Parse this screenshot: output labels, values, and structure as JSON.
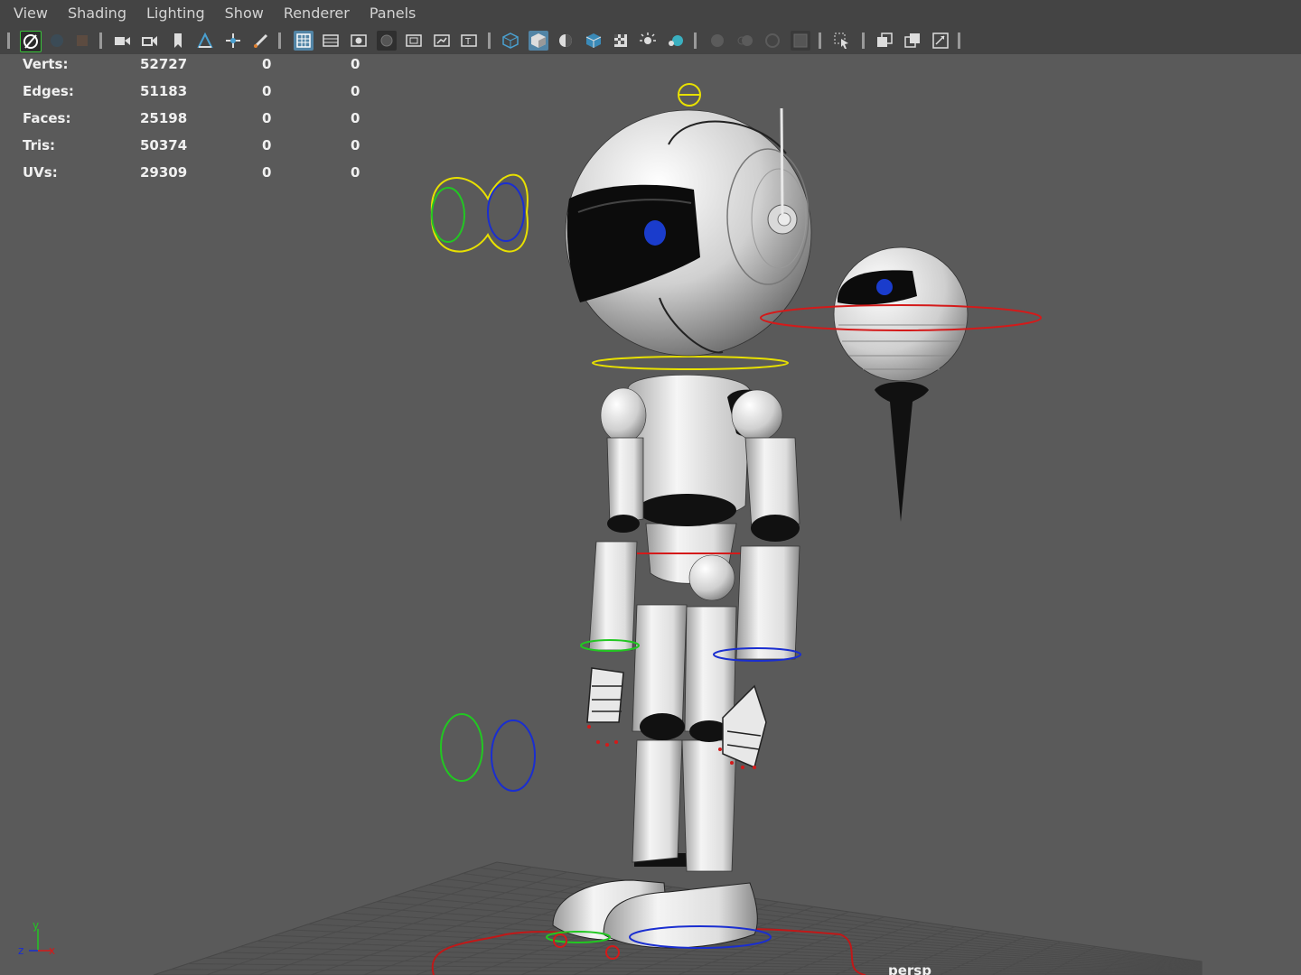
{
  "menu": {
    "items": [
      "View",
      "Shading",
      "Lighting",
      "Show",
      "Renderer",
      "Panels"
    ]
  },
  "toolbar": {
    "icons": [
      "select-camera-icon",
      "lock-camera-icon",
      "bookmark-icon",
      "camera-attributes-icon",
      "camera-bookmark-icon",
      "image-plane-icon",
      "two-d-pan-zoom-icon",
      "grease-pencil-icon",
      "grid-icon",
      "film-gate-icon",
      "resolution-gate-icon",
      "gate-mask-icon",
      "field-chart-icon",
      "safe-action-icon",
      "safe-title-icon",
      "wireframe-icon",
      "smooth-shade-icon",
      "wireframe-on-shaded-icon",
      "textured-icon",
      "use-all-lights-icon",
      "shadows-icon",
      "xray-icon",
      "isolate-select-icon",
      "ambient-occlusion-icon",
      "motion-blur-icon",
      "antialiasing-icon",
      "depth-of-field-icon",
      "xray-joints-icon",
      "pan-zoom-icon",
      "panel-layout-icon",
      "toggle-panel-icon",
      "fullscreen-icon"
    ],
    "accent_color": "#5285a6"
  },
  "hud": {
    "rows": [
      {
        "label": "Verts:",
        "values": [
          "52727",
          "0",
          "0"
        ]
      },
      {
        "label": "Edges:",
        "values": [
          "51183",
          "0",
          "0"
        ]
      },
      {
        "label": "Faces:",
        "values": [
          "25198",
          "0",
          "0"
        ]
      },
      {
        "label": "Tris:",
        "values": [
          "50374",
          "0",
          "0"
        ]
      },
      {
        "label": "UVs:",
        "values": [
          "29309",
          "0",
          "0"
        ]
      }
    ]
  },
  "viewport": {
    "camera_label": "persp",
    "axis_labels": {
      "x": "x",
      "y": "y",
      "z": "z"
    },
    "background_color": "#5a5a5a",
    "control_colors": {
      "yellow": "#e8e000",
      "green": "#22c722",
      "blue": "#1a2ed0",
      "red": "#d41a1a"
    }
  }
}
